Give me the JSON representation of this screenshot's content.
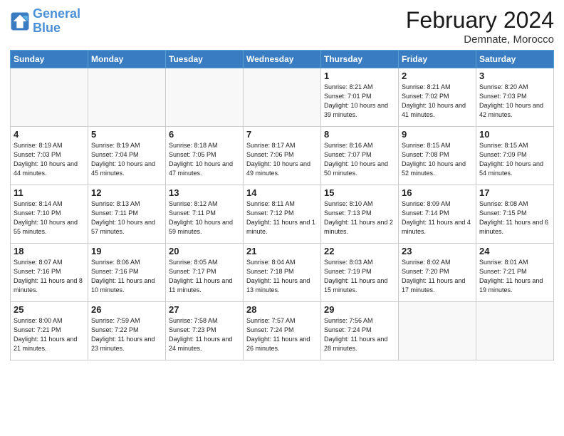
{
  "header": {
    "logo_line1": "General",
    "logo_line2": "Blue",
    "month_title": "February 2024",
    "location": "Demnate, Morocco"
  },
  "weekdays": [
    "Sunday",
    "Monday",
    "Tuesday",
    "Wednesday",
    "Thursday",
    "Friday",
    "Saturday"
  ],
  "weeks": [
    [
      {
        "day": "",
        "info": ""
      },
      {
        "day": "",
        "info": ""
      },
      {
        "day": "",
        "info": ""
      },
      {
        "day": "",
        "info": ""
      },
      {
        "day": "1",
        "info": "Sunrise: 8:21 AM\nSunset: 7:01 PM\nDaylight: 10 hours\nand 39 minutes."
      },
      {
        "day": "2",
        "info": "Sunrise: 8:21 AM\nSunset: 7:02 PM\nDaylight: 10 hours\nand 41 minutes."
      },
      {
        "day": "3",
        "info": "Sunrise: 8:20 AM\nSunset: 7:03 PM\nDaylight: 10 hours\nand 42 minutes."
      }
    ],
    [
      {
        "day": "4",
        "info": "Sunrise: 8:19 AM\nSunset: 7:03 PM\nDaylight: 10 hours\nand 44 minutes."
      },
      {
        "day": "5",
        "info": "Sunrise: 8:19 AM\nSunset: 7:04 PM\nDaylight: 10 hours\nand 45 minutes."
      },
      {
        "day": "6",
        "info": "Sunrise: 8:18 AM\nSunset: 7:05 PM\nDaylight: 10 hours\nand 47 minutes."
      },
      {
        "day": "7",
        "info": "Sunrise: 8:17 AM\nSunset: 7:06 PM\nDaylight: 10 hours\nand 49 minutes."
      },
      {
        "day": "8",
        "info": "Sunrise: 8:16 AM\nSunset: 7:07 PM\nDaylight: 10 hours\nand 50 minutes."
      },
      {
        "day": "9",
        "info": "Sunrise: 8:15 AM\nSunset: 7:08 PM\nDaylight: 10 hours\nand 52 minutes."
      },
      {
        "day": "10",
        "info": "Sunrise: 8:15 AM\nSunset: 7:09 PM\nDaylight: 10 hours\nand 54 minutes."
      }
    ],
    [
      {
        "day": "11",
        "info": "Sunrise: 8:14 AM\nSunset: 7:10 PM\nDaylight: 10 hours\nand 55 minutes."
      },
      {
        "day": "12",
        "info": "Sunrise: 8:13 AM\nSunset: 7:11 PM\nDaylight: 10 hours\nand 57 minutes."
      },
      {
        "day": "13",
        "info": "Sunrise: 8:12 AM\nSunset: 7:11 PM\nDaylight: 10 hours\nand 59 minutes."
      },
      {
        "day": "14",
        "info": "Sunrise: 8:11 AM\nSunset: 7:12 PM\nDaylight: 11 hours\nand 1 minute."
      },
      {
        "day": "15",
        "info": "Sunrise: 8:10 AM\nSunset: 7:13 PM\nDaylight: 11 hours\nand 2 minutes."
      },
      {
        "day": "16",
        "info": "Sunrise: 8:09 AM\nSunset: 7:14 PM\nDaylight: 11 hours\nand 4 minutes."
      },
      {
        "day": "17",
        "info": "Sunrise: 8:08 AM\nSunset: 7:15 PM\nDaylight: 11 hours\nand 6 minutes."
      }
    ],
    [
      {
        "day": "18",
        "info": "Sunrise: 8:07 AM\nSunset: 7:16 PM\nDaylight: 11 hours\nand 8 minutes."
      },
      {
        "day": "19",
        "info": "Sunrise: 8:06 AM\nSunset: 7:16 PM\nDaylight: 11 hours\nand 10 minutes."
      },
      {
        "day": "20",
        "info": "Sunrise: 8:05 AM\nSunset: 7:17 PM\nDaylight: 11 hours\nand 11 minutes."
      },
      {
        "day": "21",
        "info": "Sunrise: 8:04 AM\nSunset: 7:18 PM\nDaylight: 11 hours\nand 13 minutes."
      },
      {
        "day": "22",
        "info": "Sunrise: 8:03 AM\nSunset: 7:19 PM\nDaylight: 11 hours\nand 15 minutes."
      },
      {
        "day": "23",
        "info": "Sunrise: 8:02 AM\nSunset: 7:20 PM\nDaylight: 11 hours\nand 17 minutes."
      },
      {
        "day": "24",
        "info": "Sunrise: 8:01 AM\nSunset: 7:21 PM\nDaylight: 11 hours\nand 19 minutes."
      }
    ],
    [
      {
        "day": "25",
        "info": "Sunrise: 8:00 AM\nSunset: 7:21 PM\nDaylight: 11 hours\nand 21 minutes."
      },
      {
        "day": "26",
        "info": "Sunrise: 7:59 AM\nSunset: 7:22 PM\nDaylight: 11 hours\nand 23 minutes."
      },
      {
        "day": "27",
        "info": "Sunrise: 7:58 AM\nSunset: 7:23 PM\nDaylight: 11 hours\nand 24 minutes."
      },
      {
        "day": "28",
        "info": "Sunrise: 7:57 AM\nSunset: 7:24 PM\nDaylight: 11 hours\nand 26 minutes."
      },
      {
        "day": "29",
        "info": "Sunrise: 7:56 AM\nSunset: 7:24 PM\nDaylight: 11 hours\nand 28 minutes."
      },
      {
        "day": "",
        "info": ""
      },
      {
        "day": "",
        "info": ""
      }
    ]
  ]
}
